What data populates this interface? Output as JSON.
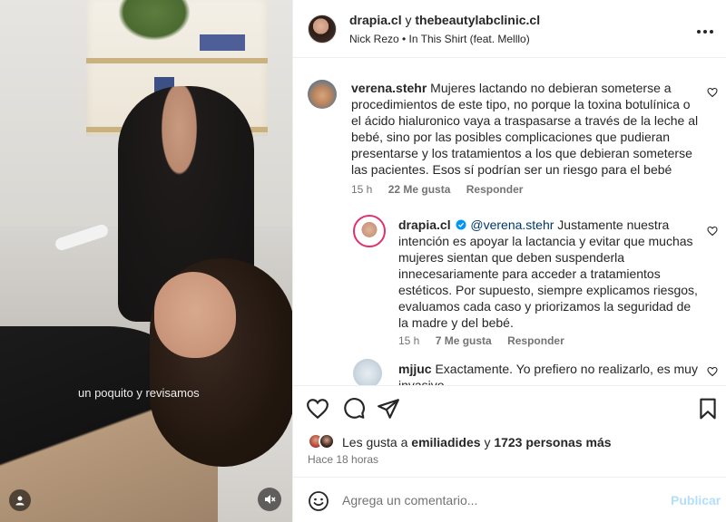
{
  "media": {
    "caption": "un poquito y revisamos"
  },
  "header": {
    "user1": "drapia.cl",
    "conj": "y",
    "user2": "thebeautylabclinic.cl",
    "audio": "Nick Rezo • In This Shirt (feat. Melllo)"
  },
  "comments": [
    {
      "username": "verena.stehr",
      "text": "Mujeres lactando no debieran someterse a procedimientos de este tipo, no porque la toxina botulínica o el ácido hialuronico vaya a traspasarse a través de la leche al bebé, sino por las posibles complicaciones que pudieran presentarse y los tratamientos a los que debieran someterse las pacientes. Esos sí podrían ser un riesgo para el bebé",
      "time": "15 h",
      "likes": "22 Me gusta",
      "reply": "Responder"
    },
    {
      "username": "drapia.cl",
      "mention": "@verena.stehr",
      "text": " Justamente nuestra intención es apoyar la lactancia y evitar que muchas mujeres sientan que deben suspenderla innecesariamente para acceder a tratamientos estéticos. Por supuesto, siempre explicamos riesgos, evaluamos cada caso y priorizamos la seguridad de la madre y del bebé.",
      "time": "15 h",
      "likes": "7 Me gusta",
      "reply": "Responder"
    },
    {
      "username": "mjjuc",
      "text": "Exactamente. Yo prefiero no realizarlo, es muy invasivo"
    }
  ],
  "likes": {
    "prefix": "Les gusta a",
    "user": "emiliadides",
    "and": "y",
    "count": "1723 personas más"
  },
  "time_ago": "Hace 18 horas",
  "composer": {
    "placeholder": "Agrega un comentario...",
    "publish": "Publicar"
  },
  "colors": {
    "text": "#262626",
    "secondary": "#737373",
    "link": "#00376b",
    "publish_disabled": "#b2dffc",
    "verified": "#0095f6"
  },
  "icons": [
    "heart-icon",
    "comment-icon",
    "share-icon",
    "bookmark-icon",
    "emoji-icon",
    "more-icon",
    "user-icon",
    "muted-icon"
  ]
}
